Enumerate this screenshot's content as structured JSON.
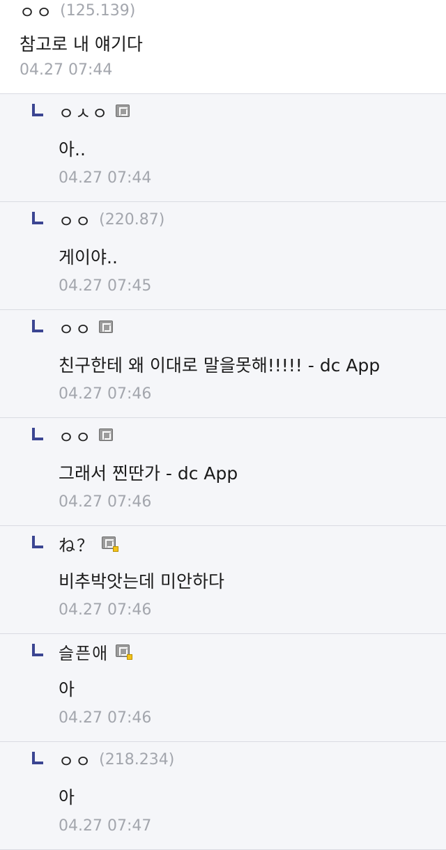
{
  "top_comment": {
    "nick": "ㅇㅇ",
    "ip": "(125.139)",
    "body": "참고로 내 얘기다",
    "time": "04.27 07:44"
  },
  "replies": [
    {
      "nick": "ㅇㅅㅇ",
      "ip": "",
      "badge": "fixed-nick-icon",
      "body": "아..",
      "time": "04.27 07:44"
    },
    {
      "nick": "ㅇㅇ",
      "ip": "(220.87)",
      "badge": "",
      "body": "게이야..",
      "time": "04.27 07:45"
    },
    {
      "nick": "ㅇㅇ",
      "ip": "",
      "badge": "fixed-nick-icon",
      "body": "친구한테 왜 이대로 말을못해!!!!! - dc App",
      "time": "04.27 07:46"
    },
    {
      "nick": "ㅇㅇ",
      "ip": "",
      "badge": "fixed-nick-icon",
      "body": "그래서 찐딴가 - dc App",
      "time": "04.27 07:46"
    },
    {
      "nick": "ね？",
      "ip": "",
      "badge": "semi-fixed-nick-icon",
      "body": "비추박앗는데 미안하다",
      "time": "04.27 07:46"
    },
    {
      "nick": "슬픈애",
      "ip": "",
      "badge": "semi-fixed-nick-icon",
      "body": "아",
      "time": "04.27 07:46"
    },
    {
      "nick": "ㅇㅇ",
      "ip": "(218.234)",
      "badge": "",
      "body": "아",
      "time": "04.27 07:47"
    }
  ],
  "colors": {
    "reply_marker": "#3b4592",
    "meta_gray": "#a3a6ad",
    "semi_fixed_dot": "#f3c21a"
  }
}
